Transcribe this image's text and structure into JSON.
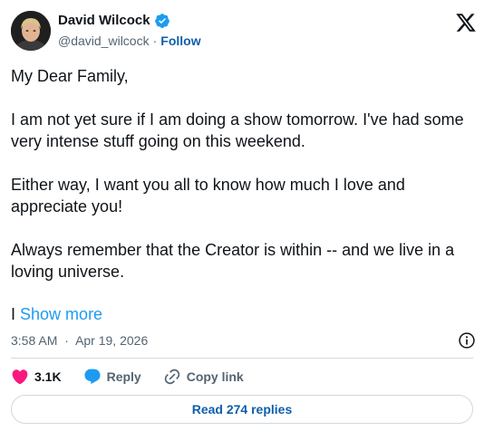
{
  "author": {
    "name": "David Wilcock",
    "handle": "@david_wilcock",
    "separator": "·",
    "follow_label": "Follow"
  },
  "tweet": {
    "paragraphs": [
      "My Dear Family,",
      "I am not yet sure if I am doing a show tomorrow. I've had some very intense stuff going on this weekend.",
      "Either way, I want you all to know how much I love and appreciate you!",
      "Always remember that the Creator is within -- and we live in a loving universe."
    ],
    "truncated_fragment": "I",
    "show_more_label": "Show more",
    "time": "3:58 AM",
    "date_separator": "·",
    "date": "Apr 19, 2026"
  },
  "actions": {
    "like_count": "3.1K",
    "reply_label": "Reply",
    "copy_link_label": "Copy link"
  },
  "replies_button_label": "Read 274 replies",
  "colors": {
    "like": "#f91880",
    "reply": "#1d9bf0",
    "link": "#0f5eaa",
    "verified": "#1d9bf0",
    "muted": "#536471",
    "border": "#cfd9de"
  },
  "icons": [
    "verified-badge-icon",
    "x-logo-icon",
    "info-icon",
    "heart-icon",
    "reply-bubble-icon",
    "link-icon"
  ]
}
